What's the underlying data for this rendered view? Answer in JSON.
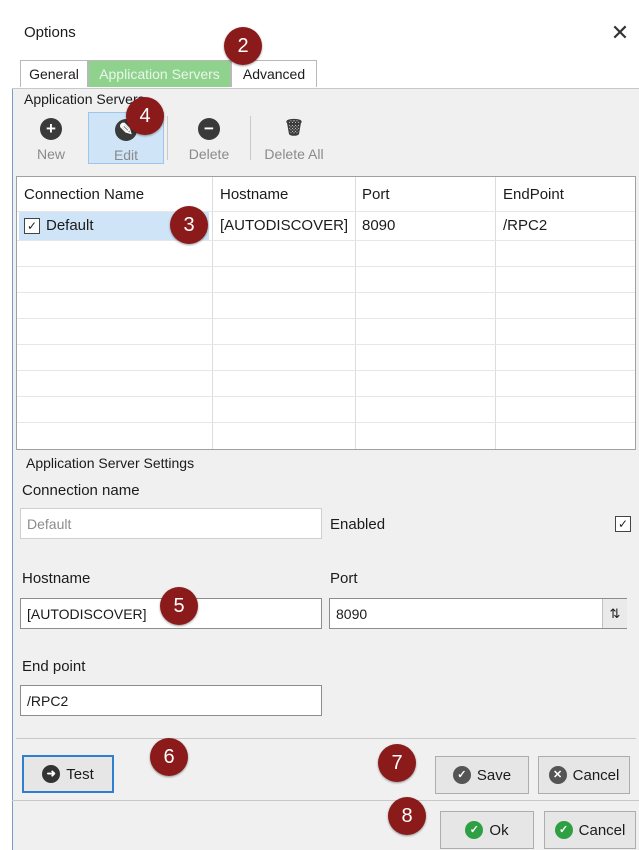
{
  "window": {
    "title": "Options",
    "close_glyph": "✕"
  },
  "tabs": [
    {
      "label": "General",
      "active": false
    },
    {
      "label": "Application Servers",
      "active": true
    },
    {
      "label": "Advanced",
      "active": false
    }
  ],
  "toolbar": {
    "group_label": "Application Servers",
    "buttons": [
      {
        "label": "New",
        "icon": "plus-circle-icon",
        "glyph": "+"
      },
      {
        "label": "Edit",
        "icon": "pencil-circle-icon",
        "glyph": "✎"
      },
      {
        "label": "Delete",
        "icon": "minus-circle-icon",
        "glyph": "−"
      },
      {
        "label": "Delete All",
        "icon": "trash-icon",
        "glyph": "🗑"
      }
    ]
  },
  "table": {
    "columns": [
      "Connection Name",
      "Hostname",
      "Port",
      "EndPoint"
    ],
    "rows": [
      {
        "checked": true,
        "name": "Default",
        "hostname": "[AUTODISCOVER]",
        "port": "8090",
        "endpoint": "/RPC2"
      }
    ]
  },
  "settings": {
    "group_label": "Application Server Settings",
    "connection_name_label": "Connection name",
    "connection_name_value": "Default",
    "enabled_label": "Enabled",
    "enabled_checked": true,
    "hostname_label": "Hostname",
    "hostname_value": "[AUTODISCOVER]",
    "port_label": "Port",
    "port_value": "8090",
    "endpoint_label": "End point",
    "endpoint_value": "/RPC2"
  },
  "buttons": {
    "test": "Test",
    "save": "Save",
    "cancel_settings": "Cancel",
    "ok": "Ok",
    "cancel_dialog": "Cancel"
  },
  "callouts": [
    "2",
    "3",
    "4",
    "5",
    "6",
    "7",
    "8"
  ],
  "colors": {
    "active_tab": "#8fd28d",
    "selection": "#cfe4f7",
    "callout": "#8b1a1a",
    "ok_icon": "#2ea043",
    "cancel_icon": "#2ea043"
  }
}
